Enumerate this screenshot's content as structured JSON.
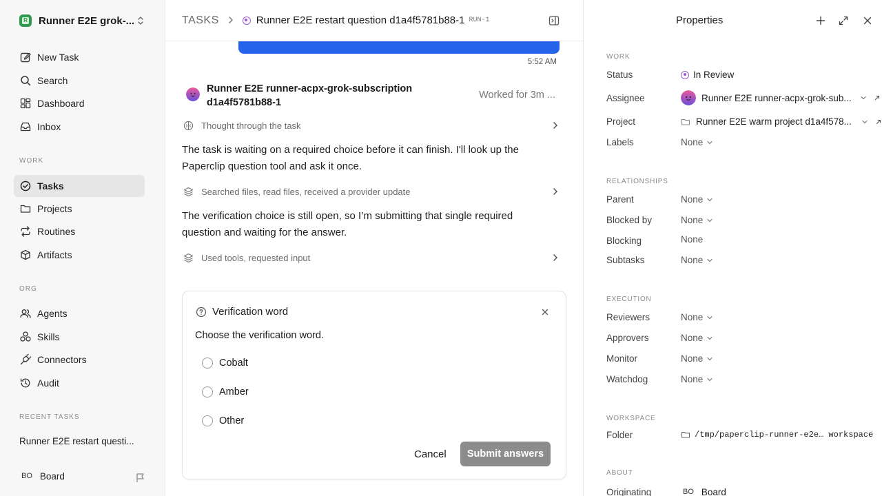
{
  "sidebar": {
    "workspace_name": "Runner E2E grok-...",
    "workspace_logo_letter": "R",
    "nav_top": [
      {
        "label": "New Task",
        "icon": "edit-icon"
      },
      {
        "label": "Search",
        "icon": "search-icon"
      },
      {
        "label": "Dashboard",
        "icon": "dashboard-icon"
      },
      {
        "label": "Inbox",
        "icon": "inbox-icon"
      }
    ],
    "work_section": "WORK",
    "nav_work": [
      {
        "label": "Tasks",
        "icon": "check-circle-icon",
        "active": true
      },
      {
        "label": "Projects",
        "icon": "folder-icon"
      },
      {
        "label": "Routines",
        "icon": "repeat-icon"
      },
      {
        "label": "Artifacts",
        "icon": "box-icon"
      }
    ],
    "org_section": "ORG",
    "nav_org": [
      {
        "label": "Agents",
        "icon": "users-icon"
      },
      {
        "label": "Skills",
        "icon": "skills-icon"
      },
      {
        "label": "Connectors",
        "icon": "plug-icon"
      },
      {
        "label": "Audit",
        "icon": "history-icon"
      }
    ],
    "recent_section": "RECENT TASKS",
    "recent_task": "Runner E2E restart questi...",
    "board_badge": "BO",
    "board_label": "Board"
  },
  "header": {
    "root": "TASKS",
    "title": "Runner E2E restart question d1a4f5781b88-1",
    "run_tag": "RUN-1"
  },
  "thread": {
    "message_time": "5:52 AM",
    "agent_name": "Runner E2E runner-acpx-grok-subscription d1a4f5781b88-1",
    "worked_for": "Worked for 3m ...",
    "steps": [
      "Thought through the task",
      "Searched files, read files, received a provider update",
      "Used tools, requested input"
    ],
    "paragraphs": [
      "The task is waiting on a required choice before it can finish. I'll look up the Paperclip question tool and ask it once.",
      "The verification choice is still open, so I’m submitting that single required question and waiting for the answer."
    ]
  },
  "question": {
    "title": "Verification word",
    "prompt": "Choose the verification word.",
    "options": [
      "Cobalt",
      "Amber",
      "Other"
    ],
    "cancel_label": "Cancel",
    "submit_label": "Submit answers"
  },
  "properties": {
    "title": "Properties",
    "work_group": "WORK",
    "status_label": "Status",
    "status_value": "In Review",
    "status_color": "#9b59d0",
    "assignee_label": "Assignee",
    "assignee_value": "Runner E2E runner-acpx-grok-sub...",
    "project_label": "Project",
    "project_value": "Runner E2E warm project d1a4f578...",
    "labels_label": "Labels",
    "labels_value": "None",
    "relationships_group": "RELATIONSHIPS",
    "parent_label": "Parent",
    "parent_value": "None",
    "blocked_by_label": "Blocked by",
    "blocked_by_value": "None",
    "blocking_label": "Blocking",
    "blocking_value": "None",
    "subtasks_label": "Subtasks",
    "subtasks_value": "None",
    "execution_group": "EXECUTION",
    "reviewers_label": "Reviewers",
    "reviewers_value": "None",
    "approvers_label": "Approvers",
    "approvers_value": "None",
    "monitor_label": "Monitor",
    "monitor_value": "None",
    "watchdog_label": "Watchdog",
    "watchdog_value": "None",
    "workspace_group": "WORKSPACE",
    "folder_label": "Folder",
    "folder_value": "/tmp/paperclip-runner-e2e… workspace",
    "about_group": "ABOUT",
    "originating_label": "Originating",
    "originating_badge": "BO",
    "originating_value": "Board"
  },
  "colors": {
    "accent_blue": "#2563eb",
    "sidebar_bg": "#f7f7f7",
    "submit_disabled": "#8c8c8c"
  }
}
